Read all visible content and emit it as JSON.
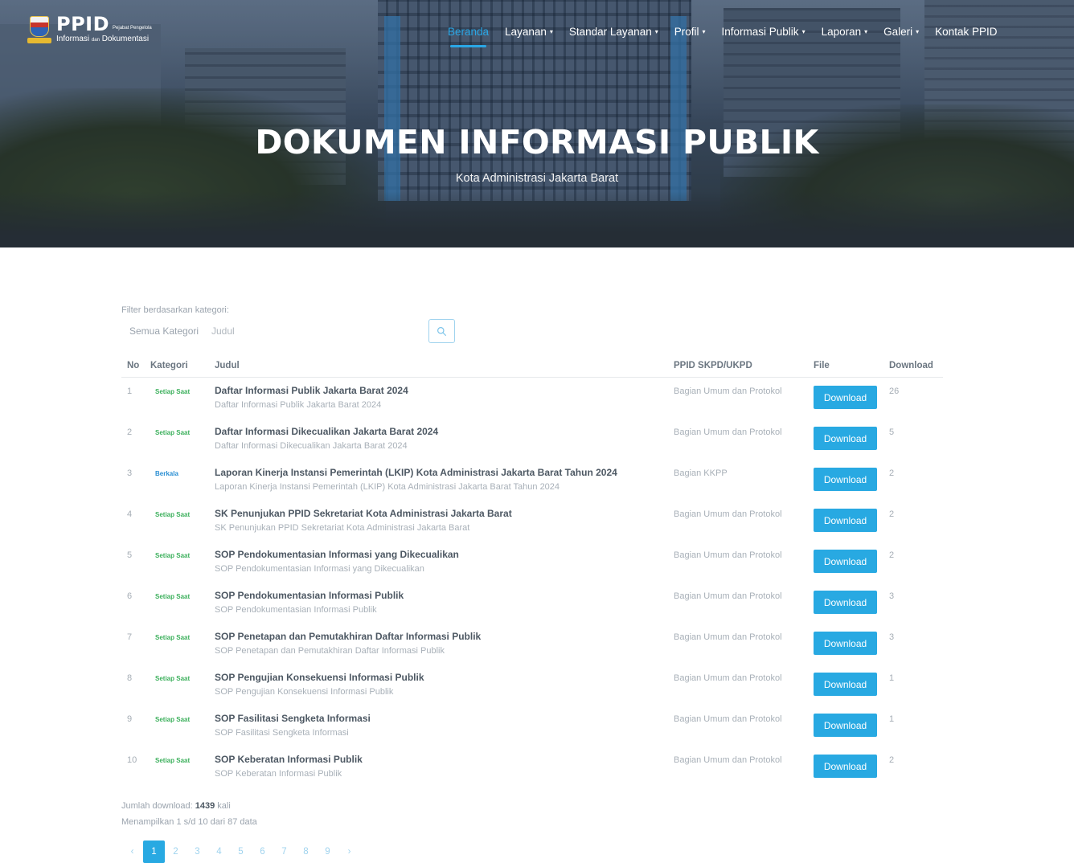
{
  "brand": {
    "name": "PPID",
    "tag_small": "Pejabat Pengelola",
    "tag_line_1": "Informasi",
    "tag_line_dan": "dan",
    "tag_line_2": "Dokumentasi"
  },
  "nav": {
    "items": [
      {
        "label": "Beranda",
        "dropdown": false,
        "active": true
      },
      {
        "label": "Layanan",
        "dropdown": true,
        "active": false
      },
      {
        "label": "Standar Layanan",
        "dropdown": true,
        "active": false
      },
      {
        "label": "Profil",
        "dropdown": true,
        "active": false
      },
      {
        "label": "Informasi Publik",
        "dropdown": true,
        "active": false
      },
      {
        "label": "Laporan",
        "dropdown": true,
        "active": false
      },
      {
        "label": "Galeri",
        "dropdown": true,
        "active": false
      },
      {
        "label": "Kontak PPID",
        "dropdown": false,
        "active": false
      }
    ],
    "caret_icon": "▾"
  },
  "hero": {
    "title": "DOKUMEN INFORMASI PUBLIK",
    "subtitle": "Kota Administrasi Jakarta Barat"
  },
  "filter": {
    "label": "Filter berdasarkan kategori:",
    "category_value": "Semua Kategori",
    "title_placeholder": "Judul",
    "search_icon": "search-icon"
  },
  "table": {
    "headers": {
      "no": "No",
      "kategori": "Kategori",
      "judul": "Judul",
      "skpd": "PPID SKPD/UKPD",
      "file": "File",
      "download": "Download"
    },
    "rows": [
      {
        "no": "1",
        "kategori": "Setiap Saat",
        "judul": "Daftar Informasi Publik Jakarta Barat 2024",
        "desc": "Daftar Informasi Publik Jakarta Barat 2024",
        "skpd": "Bagian Umum dan Protokol",
        "file": "Download",
        "download": "26"
      },
      {
        "no": "2",
        "kategori": "Setiap Saat",
        "judul": "Daftar Informasi Dikecualikan Jakarta Barat 2024",
        "desc": "Daftar Informasi Dikecualikan Jakarta Barat 2024",
        "skpd": "Bagian Umum dan Protokol",
        "file": "Download",
        "download": "5"
      },
      {
        "no": "3",
        "kategori": "Berkala",
        "judul": "Laporan Kinerja Instansi Pemerintah (LKIP) Kota Administrasi Jakarta Barat Tahun 2024",
        "desc": "Laporan Kinerja Instansi Pemerintah (LKIP) Kota Administrasi Jakarta Barat Tahun 2024",
        "skpd": "Bagian KKPP",
        "file": "Download",
        "download": "2"
      },
      {
        "no": "4",
        "kategori": "Setiap Saat",
        "judul": "SK Penunjukan PPID Sekretariat Kota Administrasi Jakarta Barat",
        "desc": "SK Penunjukan PPID Sekretariat Kota Administrasi Jakarta Barat",
        "skpd": "Bagian Umum dan Protokol",
        "file": "Download",
        "download": "2"
      },
      {
        "no": "5",
        "kategori": "Setiap Saat",
        "judul": "SOP Pendokumentasian Informasi yang Dikecualikan",
        "desc": "SOP Pendokumentasian Informasi yang Dikecualikan",
        "skpd": "Bagian Umum dan Protokol",
        "file": "Download",
        "download": "2"
      },
      {
        "no": "6",
        "kategori": "Setiap Saat",
        "judul": "SOP Pendokumentasian Informasi Publik",
        "desc": "SOP Pendokumentasian Informasi Publik",
        "skpd": "Bagian Umum dan Protokol",
        "file": "Download",
        "download": "3"
      },
      {
        "no": "7",
        "kategori": "Setiap Saat",
        "judul": "SOP Penetapan dan Pemutakhiran Daftar Informasi Publik",
        "desc": "SOP Penetapan dan Pemutakhiran Daftar Informasi Publik",
        "skpd": "Bagian Umum dan Protokol",
        "file": "Download",
        "download": "3"
      },
      {
        "no": "8",
        "kategori": "Setiap Saat",
        "judul": "SOP Pengujian Konsekuensi Informasi Publik",
        "desc": "SOP Pengujian Konsekuensi Informasi Publik",
        "skpd": "Bagian Umum dan Protokol",
        "file": "Download",
        "download": "1"
      },
      {
        "no": "9",
        "kategori": "Setiap Saat",
        "judul": "SOP Fasilitasi Sengketa Informasi",
        "desc": "SOP Fasilitasi Sengketa Informasi",
        "skpd": "Bagian Umum dan Protokol",
        "file": "Download",
        "download": "1"
      },
      {
        "no": "10",
        "kategori": "Setiap Saat",
        "judul": "SOP Keberatan Informasi Publik",
        "desc": "SOP Keberatan Informasi Publik",
        "skpd": "Bagian Umum dan Protokol",
        "file": "Download",
        "download": "2"
      }
    ]
  },
  "summary": {
    "total_label": "Jumlah download:",
    "total_value": "1439",
    "total_suffix": "kali",
    "showing": "Menampilkan 1 s/d 10 dari 87 data"
  },
  "pagination": {
    "prev": "‹",
    "pages": [
      "1",
      "2",
      "3",
      "4",
      "5",
      "6",
      "7",
      "8",
      "9"
    ],
    "current": "1",
    "next": "›"
  },
  "colors": {
    "accent": "#28a9e2",
    "category_setiap_saat": "#3cb05c",
    "category_berkala": "#2b8fd3"
  }
}
